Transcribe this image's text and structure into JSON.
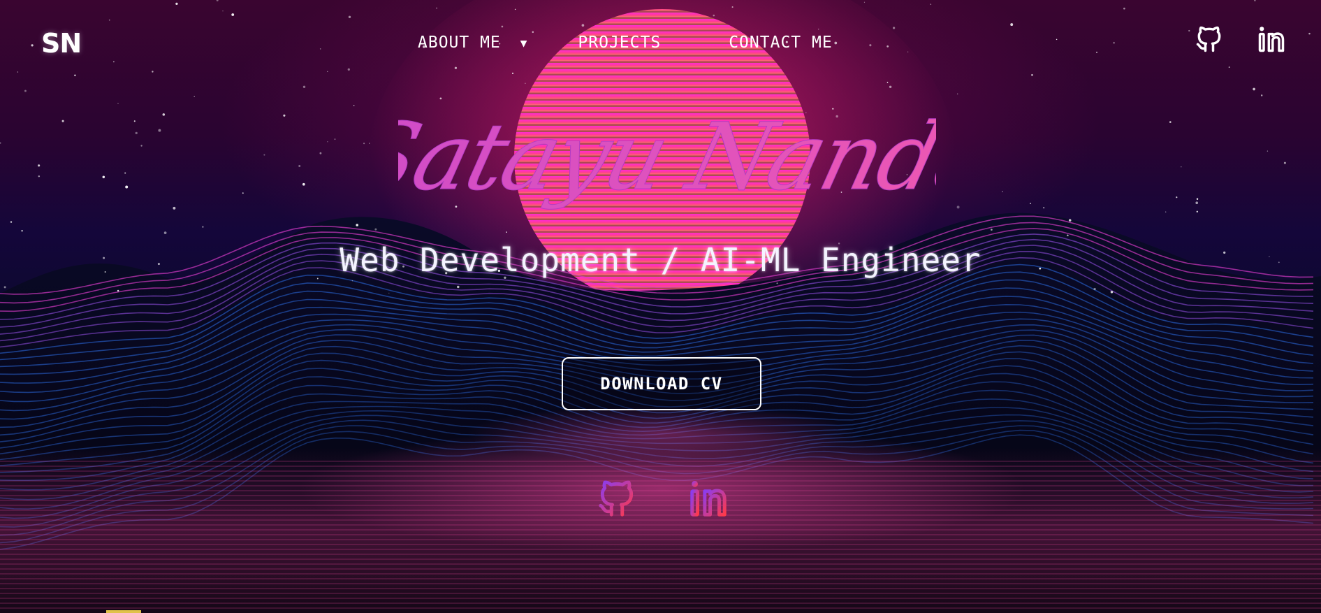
{
  "nav": {
    "logo": "SN",
    "items": [
      {
        "label": "ABOUT ME",
        "has_dropdown": true,
        "caret": "▼"
      },
      {
        "label": "PROJECTS"
      },
      {
        "label": "CONTACT ME"
      }
    ],
    "social": [
      {
        "icon": "github-icon"
      },
      {
        "icon": "linkedin-icon"
      }
    ]
  },
  "hero": {
    "name": "Satayu Nanda",
    "tagline": "Web Development / AI-ML Engineer",
    "cta_label": "DOWNLOAD CV"
  },
  "social_bottom": [
    {
      "icon": "github-icon"
    },
    {
      "icon": "linkedin-icon"
    }
  ],
  "colors": {
    "accent_pink": "#e04fb8",
    "gradient_purple": "#8a3cf0",
    "gradient_red": "#ff3a4a",
    "text": "#ffffff"
  }
}
